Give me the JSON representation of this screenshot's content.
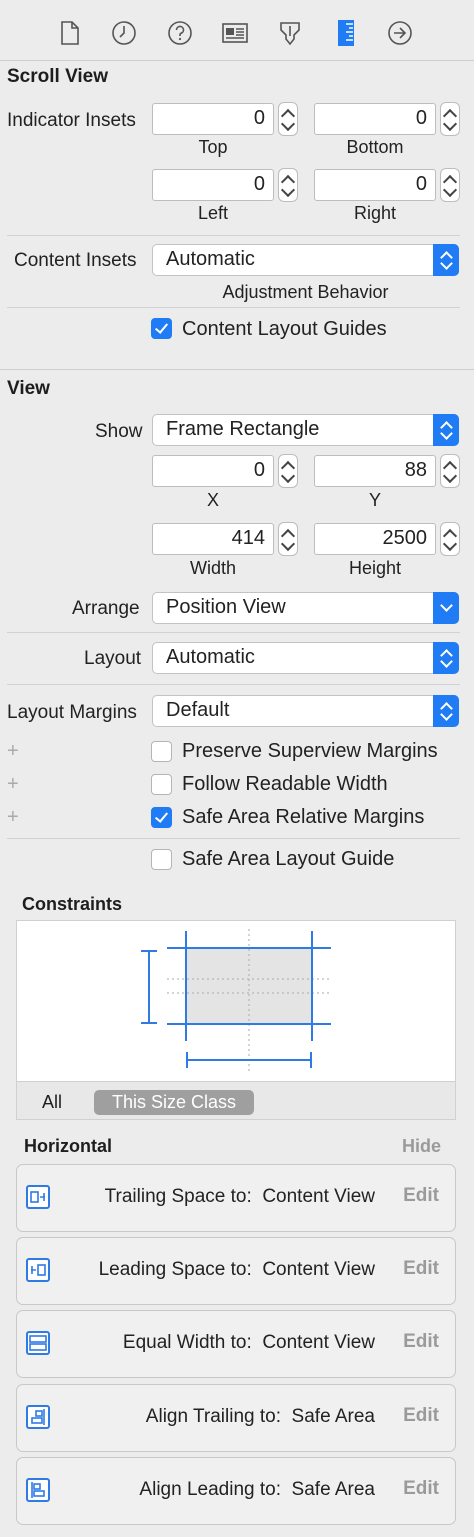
{
  "toolbar": {
    "icons": [
      "file-icon",
      "clock-icon",
      "help-icon",
      "identity-card-icon",
      "attributes-icon",
      "ruler-icon",
      "arrow-circle-icon"
    ]
  },
  "scroll_view": {
    "title": "Scroll View",
    "indicator_insets_label": "Indicator Insets",
    "top": {
      "value": "0",
      "label": "Top"
    },
    "bottom": {
      "value": "0",
      "label": "Bottom"
    },
    "left": {
      "value": "0",
      "label": "Left"
    },
    "right": {
      "value": "0",
      "label": "Right"
    },
    "content_insets_label": "Content Insets",
    "content_insets_value": "Automatic",
    "adjustment_label": "Adjustment Behavior",
    "content_layout_guides": {
      "label": "Content Layout Guides",
      "checked": true
    }
  },
  "view": {
    "title": "View",
    "show_label": "Show",
    "show_value": "Frame Rectangle",
    "x": {
      "value": "0",
      "label": "X"
    },
    "y": {
      "value": "88",
      "label": "Y"
    },
    "width": {
      "value": "414",
      "label": "Width"
    },
    "height": {
      "value": "2500",
      "label": "Height"
    },
    "arrange_label": "Arrange",
    "arrange_value": "Position View",
    "layout_label": "Layout",
    "layout_value": "Automatic",
    "layout_margins_label": "Layout Margins",
    "layout_margins_value": "Default",
    "plus": "+",
    "preserve_superview_margins": {
      "label": "Preserve Superview Margins",
      "checked": false
    },
    "follow_readable_width": {
      "label": "Follow Readable Width",
      "checked": false
    },
    "safe_area_relative_margins": {
      "label": "Safe Area Relative Margins",
      "checked": true
    },
    "safe_area_layout_guide": {
      "label": "Safe Area Layout Guide",
      "checked": false
    }
  },
  "constraints": {
    "title": "Constraints",
    "tab_all": "All",
    "tab_size_class": "This Size Class",
    "horizontal_title": "Horizontal",
    "hide_label": "Hide",
    "items": [
      {
        "relation": "Trailing Space to:",
        "target": "Content View",
        "edit": "Edit",
        "icon": "trailing-space-icon"
      },
      {
        "relation": "Leading Space to:",
        "target": "Content View",
        "edit": "Edit",
        "icon": "leading-space-icon"
      },
      {
        "relation": "Equal Width to:",
        "target": "Content View",
        "edit": "Edit",
        "icon": "equal-width-icon"
      },
      {
        "relation": "Align Trailing to:",
        "target": "Safe Area",
        "edit": "Edit",
        "icon": "align-trailing-icon"
      },
      {
        "relation": "Align Leading to:",
        "target": "Safe Area",
        "edit": "Edit",
        "icon": "align-leading-icon"
      }
    ]
  },
  "colors": {
    "accent": "#1f7cf5",
    "constraint_line": "#2f7be4"
  }
}
